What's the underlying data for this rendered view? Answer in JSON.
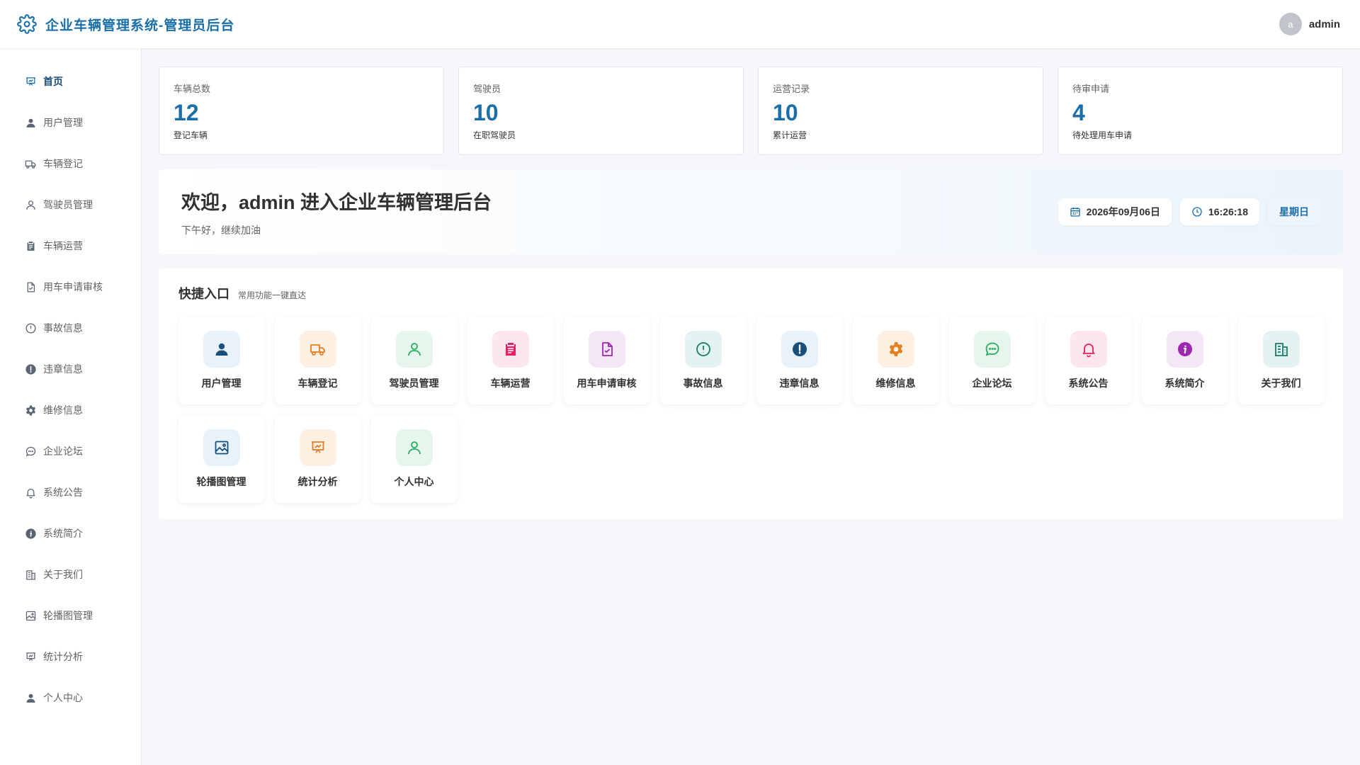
{
  "header": {
    "title": "企业车辆管理系统-管理员后台",
    "brand_icon": "gear-icon",
    "user": {
      "avatar_letter": "a",
      "name": "admin"
    }
  },
  "sidebar": {
    "items": [
      {
        "label": "首页",
        "icon": "presentation-chart-icon",
        "active": true
      },
      {
        "label": "用户管理",
        "icon": "user-icon"
      },
      {
        "label": "车辆登记",
        "icon": "truck-icon"
      },
      {
        "label": "驾驶员管理",
        "icon": "user-outline-icon"
      },
      {
        "label": "车辆运营",
        "icon": "clipboard-icon"
      },
      {
        "label": "用车申请审核",
        "icon": "document-check-icon"
      },
      {
        "label": "事故信息",
        "icon": "warning-circle-icon"
      },
      {
        "label": "违章信息",
        "icon": "warning-filled-icon"
      },
      {
        "label": "维修信息",
        "icon": "settings-icon"
      },
      {
        "label": "企业论坛",
        "icon": "chat-icon"
      },
      {
        "label": "系统公告",
        "icon": "bell-icon"
      },
      {
        "label": "系统简介",
        "icon": "info-icon"
      },
      {
        "label": "关于我们",
        "icon": "building-icon"
      },
      {
        "label": "轮播图管理",
        "icon": "picture-icon"
      },
      {
        "label": "统计分析",
        "icon": "presentation-chart-icon"
      },
      {
        "label": "个人中心",
        "icon": "user-icon"
      }
    ]
  },
  "stats": [
    {
      "label": "车辆总数",
      "value": "12",
      "sub": "登记车辆"
    },
    {
      "label": "驾驶员",
      "value": "10",
      "sub": "在职驾驶员"
    },
    {
      "label": "运营记录",
      "value": "10",
      "sub": "累计运营"
    },
    {
      "label": "待审申请",
      "value": "4",
      "sub": "待处理用车申请"
    }
  ],
  "welcome": {
    "title": "欢迎，admin 进入企业车辆管理后台",
    "subtitle": "下午好，继续加油",
    "date": "2026年09月06日",
    "time": "16:26:18",
    "weekday": "星期日"
  },
  "quick": {
    "title": "快捷入口",
    "subtitle": "常用功能一键直达",
    "tiles": [
      {
        "label": "用户管理",
        "icon": "user-icon",
        "color": "#1a4f7a",
        "bg": "#e8f2fb"
      },
      {
        "label": "车辆登记",
        "icon": "truck-icon",
        "color": "#e67e22",
        "bg": "#fdf0e3"
      },
      {
        "label": "驾驶员管理",
        "icon": "user-outline-icon",
        "color": "#27ae60",
        "bg": "#e6f6ec"
      },
      {
        "label": "车辆运营",
        "icon": "clipboard-icon",
        "color": "#e91e63",
        "bg": "#fde6ee"
      },
      {
        "label": "用车申请审核",
        "icon": "document-check-icon",
        "color": "#9c27b0",
        "bg": "#f4e6f7"
      },
      {
        "label": "事故信息",
        "icon": "warning-circle-icon",
        "color": "#1a7a6e",
        "bg": "#e3f3f1"
      },
      {
        "label": "违章信息",
        "icon": "warning-filled-icon",
        "color": "#1a4f7a",
        "bg": "#e8f2fb"
      },
      {
        "label": "维修信息",
        "icon": "settings-icon",
        "color": "#e67e22",
        "bg": "#fdf0e3"
      },
      {
        "label": "企业论坛",
        "icon": "chat-icon",
        "color": "#27ae60",
        "bg": "#e6f6ec"
      },
      {
        "label": "系统公告",
        "icon": "bell-icon",
        "color": "#e91e63",
        "bg": "#fde6ee"
      },
      {
        "label": "系统简介",
        "icon": "info-icon",
        "color": "#9c27b0",
        "bg": "#f4e6f7"
      },
      {
        "label": "关于我们",
        "icon": "building-icon",
        "color": "#1a7a6e",
        "bg": "#e3f3f1"
      },
      {
        "label": "轮播图管理",
        "icon": "picture-icon",
        "color": "#1a4f7a",
        "bg": "#e8f2fb"
      },
      {
        "label": "统计分析",
        "icon": "presentation-chart-icon",
        "color": "#e67e22",
        "bg": "#fdf0e3"
      },
      {
        "label": "个人中心",
        "icon": "user-outline-icon",
        "color": "#27ae60",
        "bg": "#e6f6ec"
      }
    ]
  }
}
